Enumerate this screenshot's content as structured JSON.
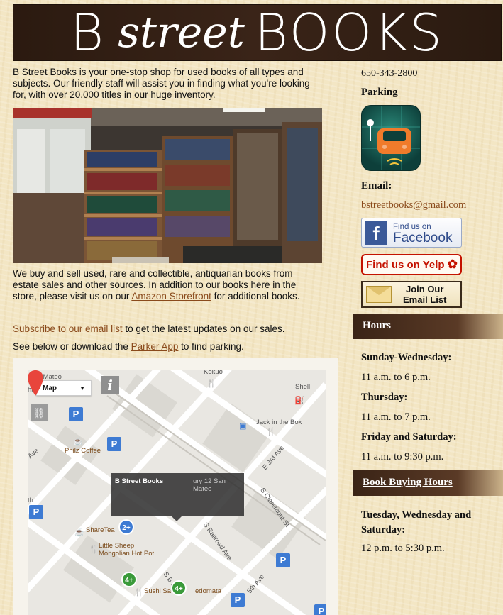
{
  "header": {
    "logo_b": "B",
    "logo_street": "street",
    "logo_books": "BOOKS"
  },
  "intro": "B Street Books is your one-stop shop for used books of all types and subjects.  Our friendly staff will assist you in finding what you're looking for, with over 20,000 titles in our huge inventory.",
  "para2": {
    "before": "We buy and sell used, rare and collectible, antiquarian books from estate sales and other sources. In addition to our books here in the store, please visit us on our ",
    "link": "Amazon Storefront",
    "after": " for additional books."
  },
  "para3": {
    "link": "Subscribe to our email list",
    "after": " to get the latest updates on our sales."
  },
  "para4": {
    "before": "See below or download the ",
    "link": "Parker App",
    "after": " to find parking."
  },
  "map": {
    "type_label": "Map",
    "info_glyph": "i",
    "link_glyph": "⛓",
    "tooltip_title": "B Street Books",
    "tooltip_sub": "ury 12 San Mateo",
    "labels": {
      "san_mateo": "San Mateo",
      "hi": "hi",
      "philz": "Philz Coffee",
      "jack": "Jack in the Box",
      "shell": "Shell",
      "e3rd": "E 3rd Ave",
      "claremont": "S Claremont St",
      "railroad": "S Railroad Ave",
      "sharetea": "ShareTea",
      "little_sheep": "Little Sheep",
      "mongolian": "Mongolian Hot Pot",
      "sushi": "Sushi Sa",
      "edomata": "edomata",
      "ave": "Ave",
      "th": "th",
      "sb": "S B S",
      "fifth": "5th Ave",
      "kokuo": "Kokuo"
    },
    "parking_glyph": "P",
    "clusters": [
      "2+",
      "4+",
      "4+"
    ]
  },
  "sidebar": {
    "phone": "650-343-2800",
    "parking_heading": "Parking",
    "email_heading": "Email:",
    "email": "bstreetbooks@gmail.com",
    "facebook": {
      "glyph": "f",
      "small": "Find us on",
      "big": "Facebook"
    },
    "yelp": "Find us on Yelp",
    "mail_list": {
      "line1": "Join Our",
      "line2": "Email List"
    },
    "hours_heading": "Hours",
    "hours": [
      {
        "day": "Sunday-Wednesday:",
        "time": "11 a.m. to 6 p.m."
      },
      {
        "day": "Thursday:",
        "time": "11 a.m. to 7 p.m."
      },
      {
        "day": "Friday and Saturday:",
        "time": "11 a.m. to 9:30 p.m."
      }
    ],
    "buying_heading": "Book Buying Hours",
    "buying_days": "Tuesday, Wednesday and Saturday:",
    "buying_time": "12 p.m. to 5:30 p.m."
  },
  "colors": {
    "link": "#8a4a1c",
    "header_bg": "#2b1a10",
    "yelp_red": "#c41200",
    "facebook_blue": "#3b5998",
    "map_pin_blue": "#3e7bd3"
  }
}
